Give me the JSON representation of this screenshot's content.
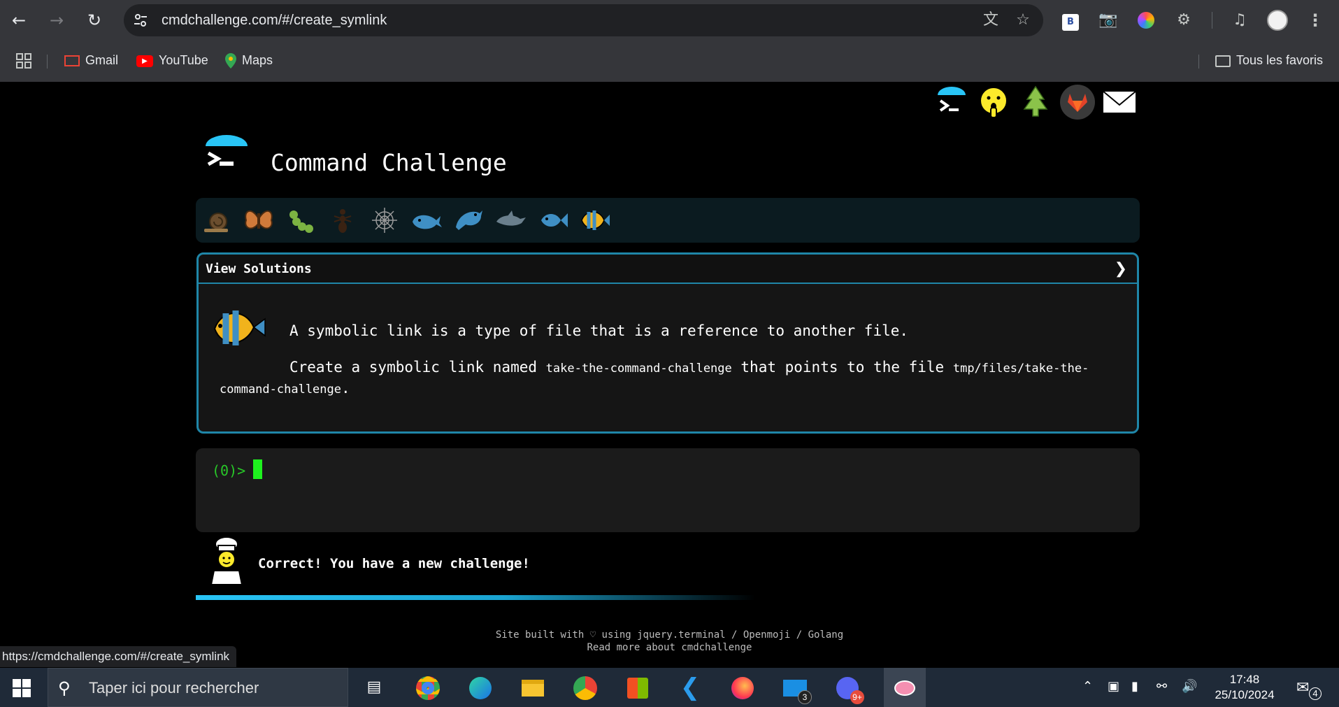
{
  "browser": {
    "url": "cmdchallenge.com/#/create_symlink",
    "bookmarks": [
      {
        "label": "Gmail",
        "icon": "gmail-icon"
      },
      {
        "label": "YouTube",
        "icon": "youtube-icon"
      },
      {
        "label": "Maps",
        "icon": "maps-icon"
      }
    ],
    "all_bookmarks_label": "Tous les favoris",
    "status_url": "https://cmdchallenge.com/#/create_symlink"
  },
  "page": {
    "title": "Command Challenge",
    "level_icons": [
      "snail",
      "butterfly",
      "caterpillar",
      "ant",
      "spider-web",
      "whale",
      "dolphin-dark",
      "dolphin-grey",
      "fish",
      "tropical-fish"
    ],
    "panel": {
      "header": "View Solutions",
      "line1": "A symbolic link is a type of file that is a reference to another file.",
      "line2_pre": "Create a symbolic link named ",
      "line2_code1": "take-the-command-challenge",
      "line2_mid": " that points to the file ",
      "line2_code2": "tmp/files/take-the-command-challenge",
      "line2_post": "."
    },
    "terminal": {
      "prompt": "(0)>"
    },
    "feedback": "Correct! You have a new challenge!",
    "footer": {
      "line1": "Site built with ♡ using jquery.terminal / Openmoji / Golang",
      "line2": "Read more about cmdchallenge"
    },
    "colors": {
      "accent": "#1f86a8",
      "prompt": "#28c828",
      "cursor": "#1ef21e",
      "progress": "#29c5f6"
    }
  },
  "taskbar": {
    "search_placeholder": "Taper ici pour rechercher",
    "mail_badge": "3",
    "discord_badge": "9+",
    "time": "17:48",
    "date": "25/10/2024",
    "notification_count": "4"
  }
}
